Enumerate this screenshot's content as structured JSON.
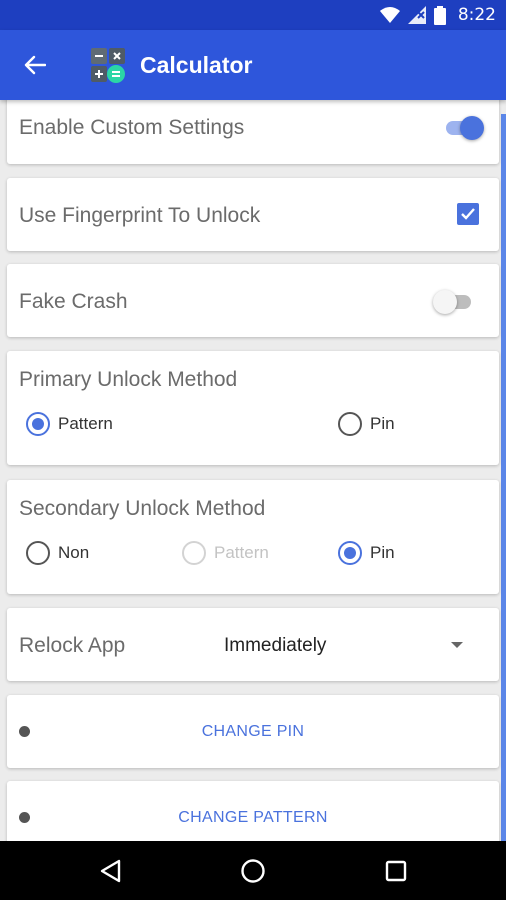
{
  "status_bar": {
    "time": "8:22"
  },
  "app_bar": {
    "title": "Calculator"
  },
  "settings": {
    "enable_custom": {
      "label": "Enable Custom Settings",
      "on": true
    },
    "fingerprint": {
      "label": "Use Fingerprint To Unlock",
      "checked": true
    },
    "fake_crash": {
      "label": "Fake Crash",
      "on": false
    },
    "primary_unlock": {
      "label": "Primary Unlock Method",
      "options": [
        {
          "label": "Pattern",
          "selected": true,
          "enabled": true
        },
        {
          "label": "Pin",
          "selected": false,
          "enabled": true
        }
      ]
    },
    "secondary_unlock": {
      "label": "Secondary Unlock Method",
      "options": [
        {
          "label": "Non",
          "selected": false,
          "enabled": true
        },
        {
          "label": "Pattern",
          "selected": false,
          "enabled": false
        },
        {
          "label": "Pin",
          "selected": true,
          "enabled": true
        }
      ]
    },
    "relock": {
      "label": "Relock App",
      "value": "Immediately"
    },
    "change_pin": {
      "label": "CHANGE PIN"
    },
    "change_pattern": {
      "label": "CHANGE PATTERN"
    }
  },
  "colors": {
    "status_bar": "#1e3fc0",
    "app_bar": "#2e56db",
    "accent": "#4a72dd",
    "background": "#ececec"
  }
}
